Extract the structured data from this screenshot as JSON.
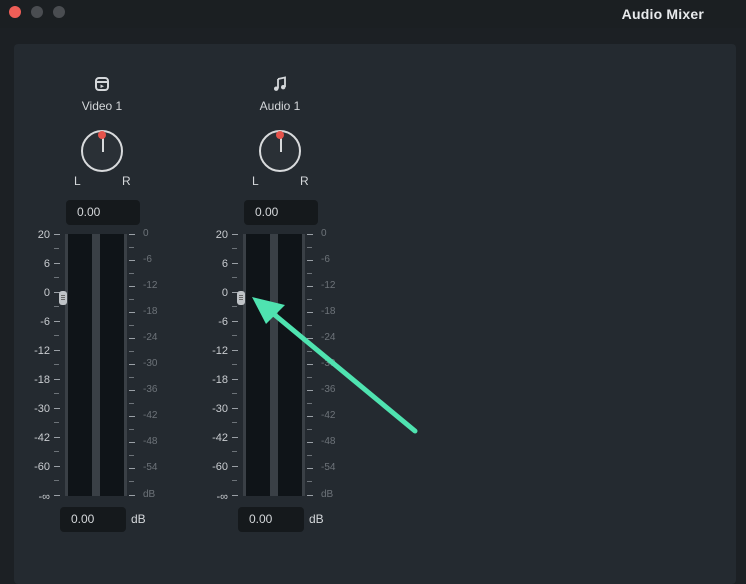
{
  "window": {
    "title": "Audio Mixer"
  },
  "tracks": [
    {
      "name": "Video  1",
      "icon": "video-track-icon",
      "pan_value": "0.00",
      "volume_value": "0.00",
      "unit": "dB",
      "left_label": "L",
      "right_label": "R"
    },
    {
      "name": "Audio  1",
      "icon": "music-note-icon",
      "pan_value": "0.00",
      "volume_value": "0.00",
      "unit": "dB",
      "left_label": "L",
      "right_label": "R"
    }
  ],
  "left_scale": [
    "20",
    "6",
    "0",
    "-6",
    "-12",
    "-18",
    "-30",
    "-42",
    "-60",
    "-∞"
  ],
  "right_scale": [
    "0",
    "-6",
    "-12",
    "-18",
    "-24",
    "-30",
    "-36",
    "-42",
    "-48",
    "-54",
    "dB"
  ],
  "colors": {
    "accent_arrow": "#4fe3b0",
    "knob_dot": "#e5534b"
  }
}
